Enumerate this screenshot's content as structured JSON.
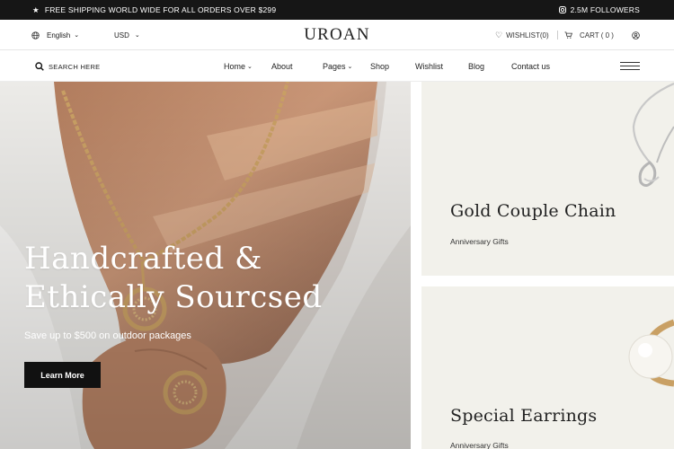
{
  "announcement": {
    "shipping_text": "FREE SHIPPING WORLD WIDE FOR ALL ORDERS OVER $299",
    "followers_text": "2.5M FOLLOWERS"
  },
  "header": {
    "language": "English",
    "currency": "USD",
    "logo": "UROAN",
    "wishlist": "WISHLIST(0)",
    "cart": "CART ( 0 )"
  },
  "nav": {
    "search_placeholder": "SEARCH HERE",
    "items": [
      "Home",
      "About",
      "Pages",
      "Shop",
      "Wishlist",
      "Blog",
      "Contact us"
    ]
  },
  "hero": {
    "title_line1": "Handcrafted &",
    "title_line2": "Ethically Sourcsed",
    "subtitle": "Save up to $500 on outdoor packages",
    "button": "Learn More"
  },
  "promos": [
    {
      "title": "Gold Couple Chain",
      "subtitle": "Anniversary Gifts"
    },
    {
      "title": "Special Earrings",
      "subtitle": "Anniversary Gifts"
    }
  ],
  "colors": {
    "topbar": "#161616",
    "panel": "#f2f1eb",
    "gold": "#c9a064",
    "button": "#111111"
  }
}
